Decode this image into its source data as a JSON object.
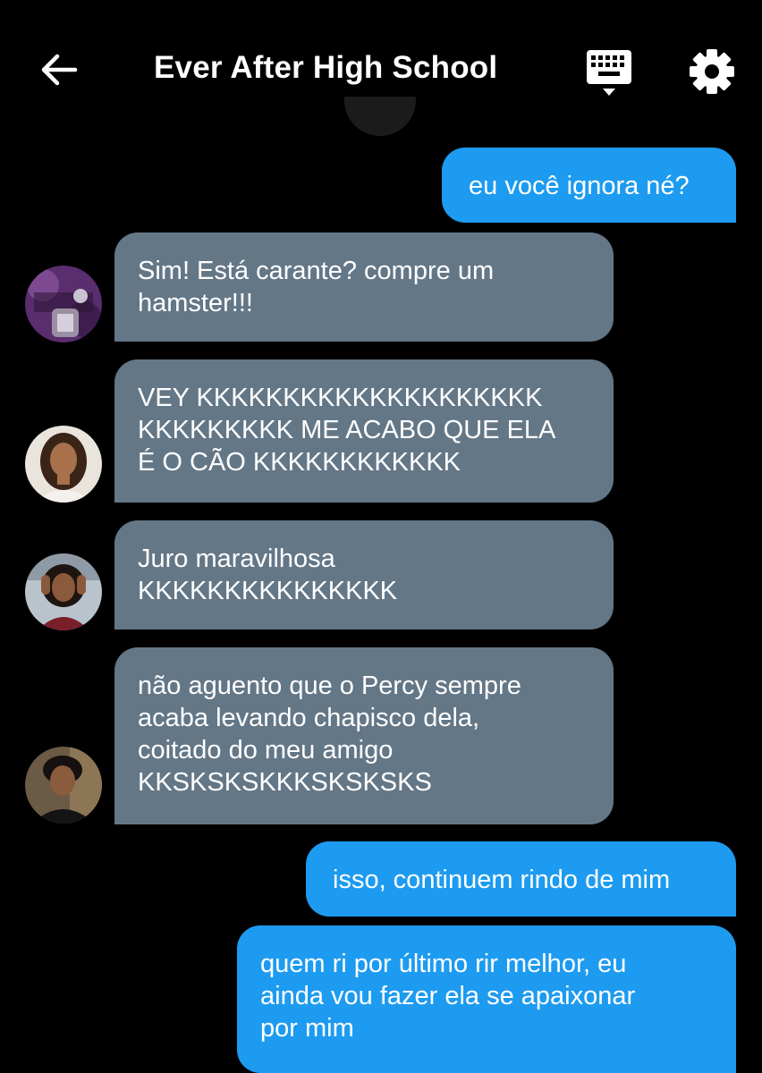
{
  "header": {
    "title": "Ever After High School",
    "back_icon": "arrow-left-icon",
    "keyboard_icon": "keyboard-icon",
    "settings_icon": "gear-icon"
  },
  "colors": {
    "background": "#000000",
    "outgoing_bubble": "#1d9bf0",
    "incoming_bubble": "#647787",
    "text": "#ffffff"
  },
  "messages": [
    {
      "direction": "outgoing",
      "text": "eu você ignora né?"
    },
    {
      "direction": "incoming",
      "avatar": "avatar-rebels-logo",
      "text": "Sim! Está carante? compre um\nhamster!!!"
    },
    {
      "direction": "incoming",
      "avatar": "avatar-girl-1",
      "text": "VEY KKKKKKKKKKKKKKKKKKKK\nKKKKKKKKK ME ACABO QUE ELA\nÉ O CÃO KKKKKKKKKKKK"
    },
    {
      "direction": "incoming",
      "avatar": "avatar-girl-2",
      "text": "Juro maravilhosa\nKKKKKKKKKKKKKKK"
    },
    {
      "direction": "incoming",
      "avatar": "avatar-boy",
      "text": "não aguento que o Percy sempre\nacaba levando chapisco dela,\ncoitado do meu amigo\nKKSKSKSKKKSKSKSKS"
    },
    {
      "direction": "outgoing",
      "text": "isso, continuem rindo de mim"
    },
    {
      "direction": "outgoing",
      "text": "quem ri por último rir melhor, eu\nainda vou fazer ela se apaixonar\npor mim"
    }
  ]
}
